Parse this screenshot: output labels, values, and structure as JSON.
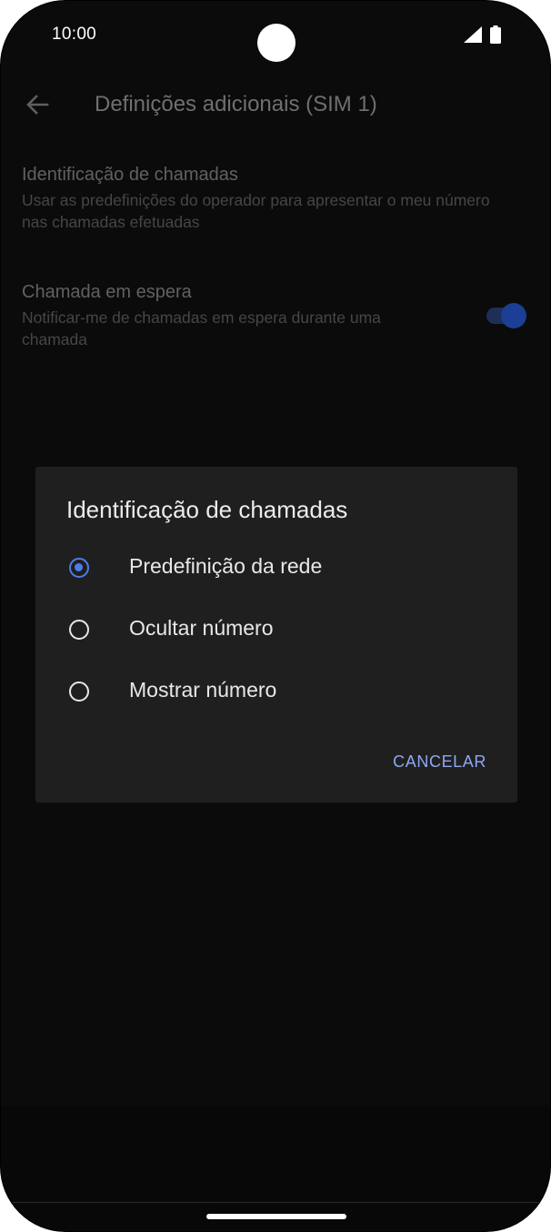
{
  "status_bar": {
    "time": "10:00",
    "icons": [
      "signal-icon",
      "battery-icon"
    ]
  },
  "app_bar": {
    "back_icon": "arrow-left",
    "title": "Definições adicionais (SIM 1)"
  },
  "settings": [
    {
      "title": "Identificação de chamadas",
      "summary": "Usar as predefinições do operador para apresentar o meu número nas chamadas efetuadas"
    },
    {
      "title": "Chamada em espera",
      "summary": "Notificar-me de chamadas em espera durante uma chamada",
      "toggle_on": true
    }
  ],
  "dialog": {
    "title": "Identificação de chamadas",
    "options": [
      {
        "label": "Predefinição da rede",
        "selected": true
      },
      {
        "label": "Ocultar número",
        "selected": false
      },
      {
        "label": "Mostrar número",
        "selected": false
      }
    ],
    "cancel_label": "CANCELAR"
  },
  "colors": {
    "accent": "#4d7de8",
    "dialog_background": "#1f1f1f",
    "cancel_text": "#8ea7f2"
  }
}
